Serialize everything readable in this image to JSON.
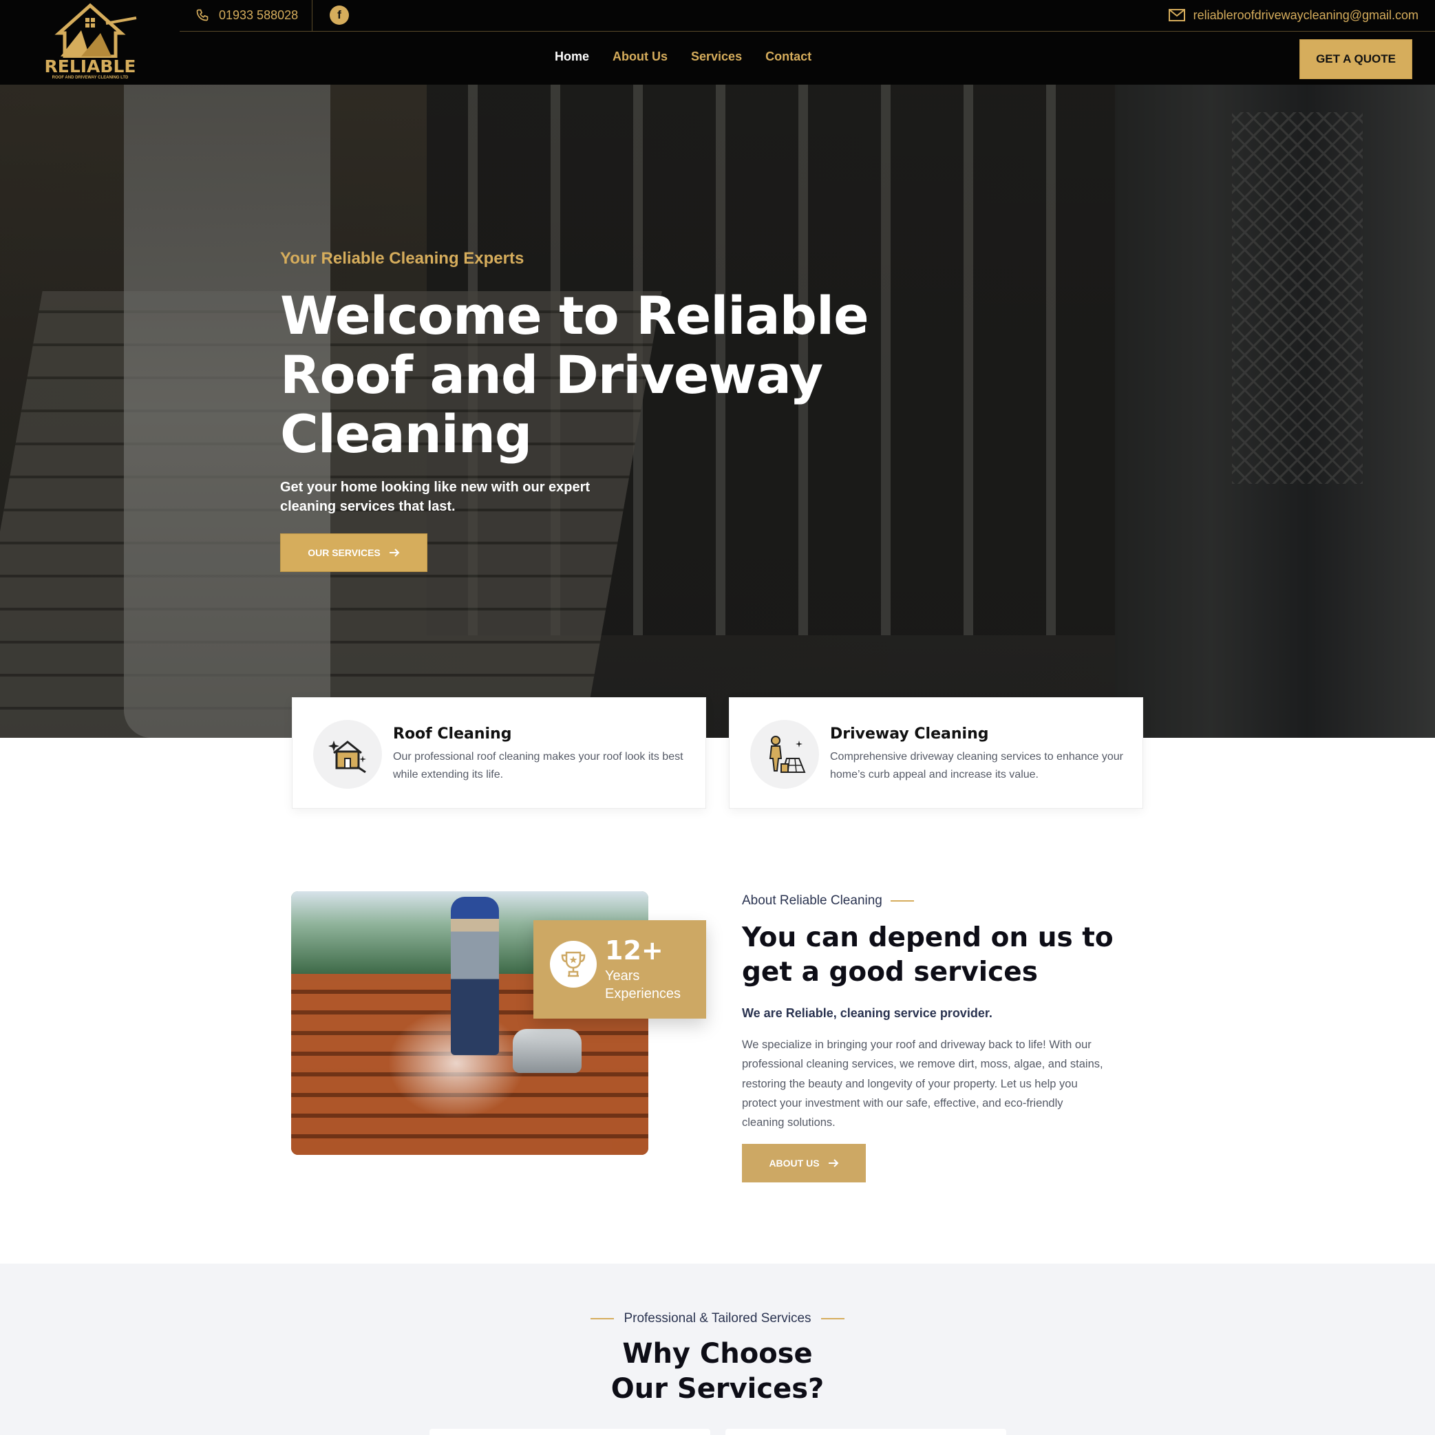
{
  "header": {
    "logo_text": "RELIABLE",
    "logo_sub": "ROOF AND DRIVEWAY CLEANING LTD",
    "phone": "01933 588028",
    "facebook_icon": "facebook-icon",
    "email": "reliableroofdrivewaycleaning@gmail.com",
    "nav": [
      {
        "label": "Home",
        "active": true
      },
      {
        "label": "About Us",
        "active": false
      },
      {
        "label": "Services",
        "active": false
      },
      {
        "label": "Contact",
        "active": false
      }
    ],
    "quote_button": "GET A QUOTE"
  },
  "hero": {
    "kicker": "Your Reliable Cleaning Experts",
    "title": "Welcome to Reliable Roof and Driveway Cleaning",
    "subtitle": "Get your home looking like new with our expert cleaning services that last.",
    "button": "OUR SERVICES"
  },
  "cards": [
    {
      "title": "Roof Cleaning",
      "text": "Our professional roof cleaning makes your roof look its best while extending its life.",
      "icon": "roof-cleaning-icon"
    },
    {
      "title": "Driveway Cleaning",
      "text": "Comprehensive driveway cleaning services to enhance your home’s curb appeal and increase its value.",
      "icon": "driveway-cleaning-icon"
    }
  ],
  "about": {
    "badge_number": "12+",
    "badge_label": "Years Experiences",
    "kicker": "About Reliable Cleaning",
    "title": "You can depend on us to get a good services",
    "lead": "We are Reliable, cleaning service provider.",
    "body": "We specialize in bringing your roof and driveway back to life! With our professional cleaning services, we remove dirt, moss, algae, and stains, restoring the beauty and longevity of your property. Let us help you protect your investment with our safe, effective, and eco-friendly cleaning solutions.",
    "button": "ABOUT US"
  },
  "why": {
    "kicker": "Professional & Tailored Services",
    "title": "Why Choose Our Services?"
  },
  "colors": {
    "accent": "#d6ad5c",
    "header_bg": "#050505",
    "section_bg": "#f3f4f7"
  }
}
